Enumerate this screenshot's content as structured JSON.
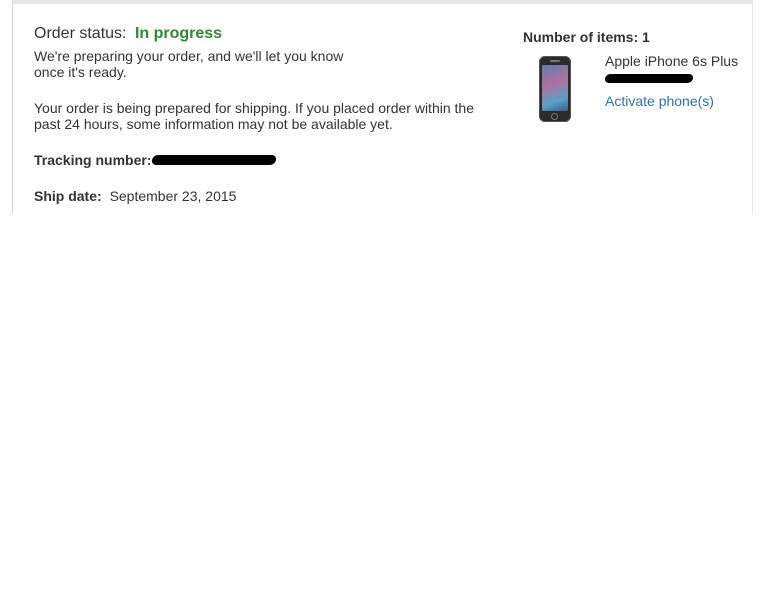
{
  "order": {
    "status_label": "Order status:",
    "status_value": "In progress",
    "status_color": "#2e8b2e",
    "preparing_message": "We're preparing your order, and we'll let you know once it's ready.",
    "shipping_message": "Your order is being prepared for shipping. If you placed order within the past 24 hours, some information may not be available yet.",
    "tracking_label": "Tracking number:",
    "ship_date_label": "Ship date:",
    "ship_date_value": "September 23, 2015"
  },
  "items": {
    "count_label": "Number of items: 1",
    "product_name": "Apple iPhone 6s Plus",
    "product_image_icon": "phone-icon",
    "activate_link": "Activate phone(s)",
    "link_color": "#2a73a8"
  }
}
